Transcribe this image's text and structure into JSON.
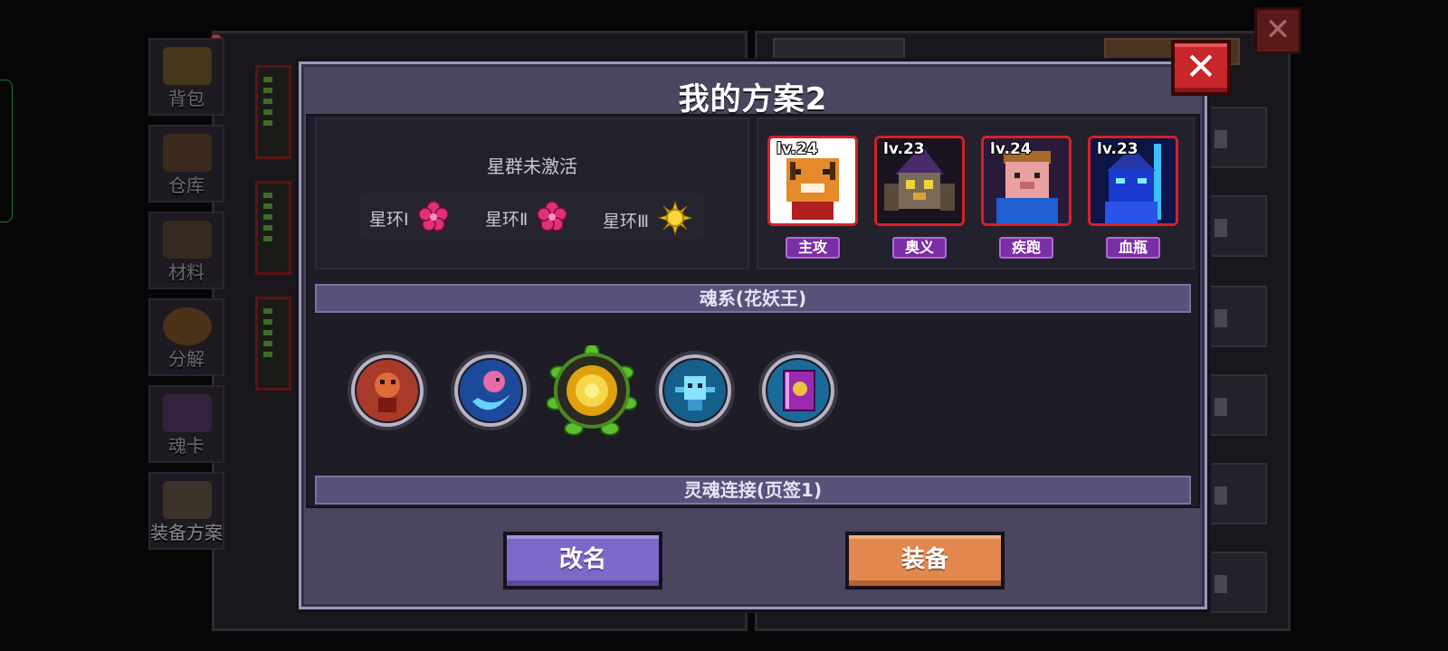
{
  "dialog": {
    "title": "我的方案2",
    "close_icon": "close-icon",
    "constellation": {
      "status": "星群未激活",
      "rings": [
        {
          "label": "星环Ⅰ",
          "gem": "pink-flower-gem-icon"
        },
        {
          "label": "星环Ⅱ",
          "gem": "pink-flower-gem-icon"
        },
        {
          "label": "星环Ⅲ",
          "gem": "yellow-sun-gem-icon"
        }
      ]
    },
    "heroes": [
      {
        "level": "lv.24",
        "role": "主攻",
        "portrait": "tiger-hero-icon"
      },
      {
        "level": "lv.23",
        "role": "奥义",
        "portrait": "owl-wizard-hero-icon"
      },
      {
        "level": "lv.24",
        "role": "疾跑",
        "portrait": "pig-hero-icon"
      },
      {
        "level": "lv.23",
        "role": "血瓶",
        "portrait": "blue-knight-hero-icon"
      }
    ],
    "soul_section_title": "魂系(花妖王)",
    "souls": [
      {
        "icon": "fire-demon-soul-icon"
      },
      {
        "icon": "pink-bird-soul-icon"
      },
      {
        "icon": "flower-king-soul-icon"
      },
      {
        "icon": "ice-spirit-soul-icon"
      },
      {
        "icon": "purple-book-soul-icon"
      }
    ],
    "link_section_title": "灵魂连接(页签1)",
    "rename_button": "改名",
    "equip_button": "装备"
  },
  "sidebar": {
    "tabs": [
      {
        "label": "背包",
        "icon": "chest-icon"
      },
      {
        "label": "仓库",
        "icon": "warehouse-icon"
      },
      {
        "label": "材料",
        "icon": "material-icon"
      },
      {
        "label": "分解",
        "icon": "decompose-icon"
      },
      {
        "label": "魂卡",
        "icon": "soul-card-icon"
      },
      {
        "label": "装备方案",
        "icon": "equipment-plan-icon"
      }
    ]
  },
  "colors": {
    "dialog_bg": "#4b4560",
    "hero_border": "#d81f2a",
    "hero_tag": "#7b2fa6",
    "rename_button": "#7d68c9",
    "equip_button": "#e2874d",
    "close_button": "#c7262a"
  }
}
